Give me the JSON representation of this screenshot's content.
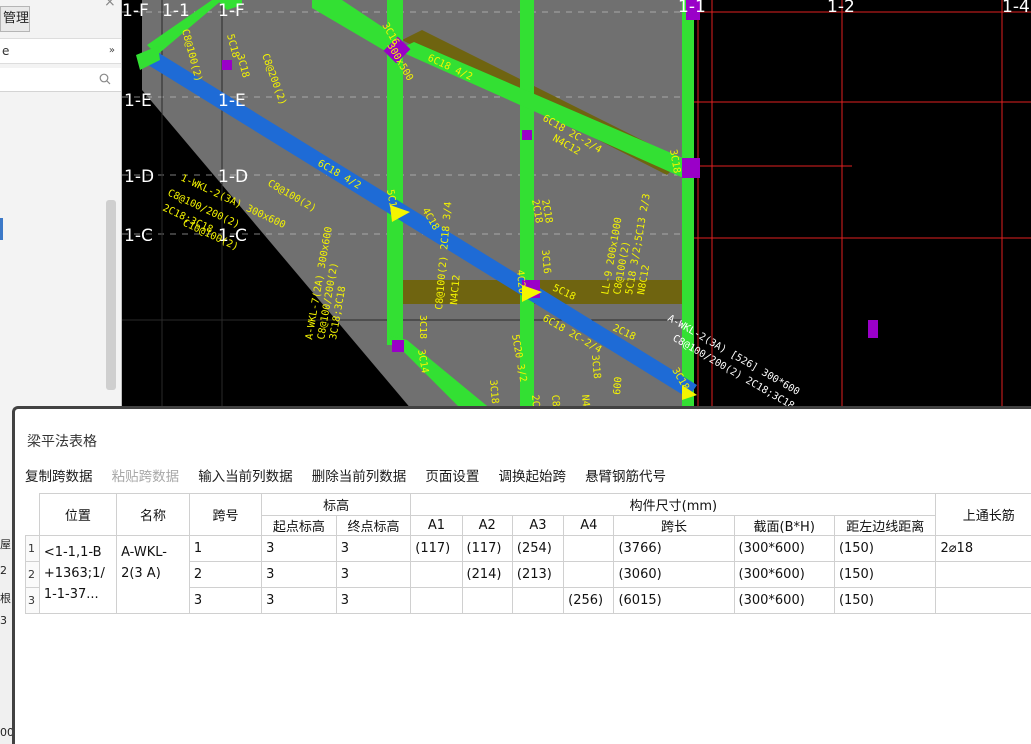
{
  "left_panel": {
    "tab_label": "管理",
    "row_label": "e",
    "double_arrow": "»",
    "strip_items": [
      "屋",
      "2",
      "根",
      "3",
      "00"
    ]
  },
  "cad": {
    "axis_labels_top": [
      "1-F",
      "1-1",
      "1-F",
      "1-1",
      "1-2",
      "1-4"
    ],
    "axis_labels_left": [
      "1-E",
      "1-E",
      "1-D",
      "1-D",
      "1-C",
      "1-C"
    ],
    "annotations": [
      "3C16",
      "300x500",
      "5C18",
      "3C18",
      "C8@100(2)",
      "C8@200(2)",
      "6C18 4/2",
      "6C18 2C-2/4",
      "N4C12",
      "3C18",
      "6C18 4/2",
      "2C18",
      "C8@100(2)",
      "5C18",
      "4C18",
      "2C18",
      "4C20",
      "3C16",
      "3C18",
      "3C18",
      "5C20 3/2",
      "5C18",
      "6C18 2C-2/4",
      "2C18",
      "3C18",
      "3C14",
      "3C18",
      "2C18",
      "C8@100(2)",
      "N4C12",
      "600",
      "A-WKL-7(2A) 300x600",
      "C8@100/200(2)",
      "3C18;3C18",
      "LL-9 200x1000",
      "C8@100(2)",
      "5C18 3/2;5C13 2/3",
      "N8C12",
      "A-WKL-2(3A) [526] 300*600",
      "C8@100/200(2) 2C18;3C18",
      "1-WKL-2(3A) 300x600",
      "C8@100/200(2)",
      "2C18;3C18",
      "C10@100(2)",
      "C8@100(2) 2C18 3/4",
      "N4C12"
    ]
  },
  "dialog": {
    "title": "梁平法表格",
    "toolbar": [
      {
        "label": "复制跨数据",
        "enabled": true
      },
      {
        "label": "粘贴跨数据",
        "enabled": false
      },
      {
        "label": "输入当前列数据",
        "enabled": true
      },
      {
        "label": "删除当前列数据",
        "enabled": true
      },
      {
        "label": "页面设置",
        "enabled": true
      },
      {
        "label": "调换起始跨",
        "enabled": true
      },
      {
        "label": "悬臂钢筋代号",
        "enabled": true
      }
    ],
    "headers": {
      "position": "位置",
      "name": "名称",
      "span_no": "跨号",
      "elevation": "标高",
      "start_elev": "起点标高",
      "end_elev": "终点标高",
      "dims": "构件尺寸(mm)",
      "a1": "A1",
      "a2": "A2",
      "a3": "A3",
      "a4": "A4",
      "span_len": "跨长",
      "section": "截面(B*H)",
      "left_edge": "距左边线距离",
      "top_long": "上通长筋"
    },
    "position_text": "<1-1,1-B +1363;1/ 1-1-37...",
    "name_text": "A-WKL-2(3 A)",
    "rows": [
      {
        "rn": "1",
        "span": "1",
        "start": "3",
        "end": "3",
        "a1": "(117)",
        "a2": "(117)",
        "a3": "(254)",
        "a4": "",
        "len": "(3766)",
        "sec": "(300*600)",
        "left": "(150)",
        "top": "2⌀18"
      },
      {
        "rn": "2",
        "span": "2",
        "start": "3",
        "end": "3",
        "a1": "",
        "a2": "(214)",
        "a3": "(213)",
        "a4": "",
        "len": "(3060)",
        "sec": "(300*600)",
        "left": "(150)",
        "top": ""
      },
      {
        "rn": "3",
        "span": "3",
        "start": "3",
        "end": "3",
        "a1": "",
        "a2": "",
        "a3": "",
        "a4": "(256)",
        "len": "(6015)",
        "sec": "(300*600)",
        "left": "(150)",
        "top": ""
      }
    ]
  },
  "colors": {
    "cad_bg": "#000000",
    "green_beam": "#33e033",
    "blue_beam": "#1e6bd6",
    "olive_beam": "#7a6e10",
    "gray_slab": "#6f6f6f",
    "axis_red": "#e02020",
    "magenta_marker": "#9a00c8",
    "yellow_text": "#f5f500"
  }
}
